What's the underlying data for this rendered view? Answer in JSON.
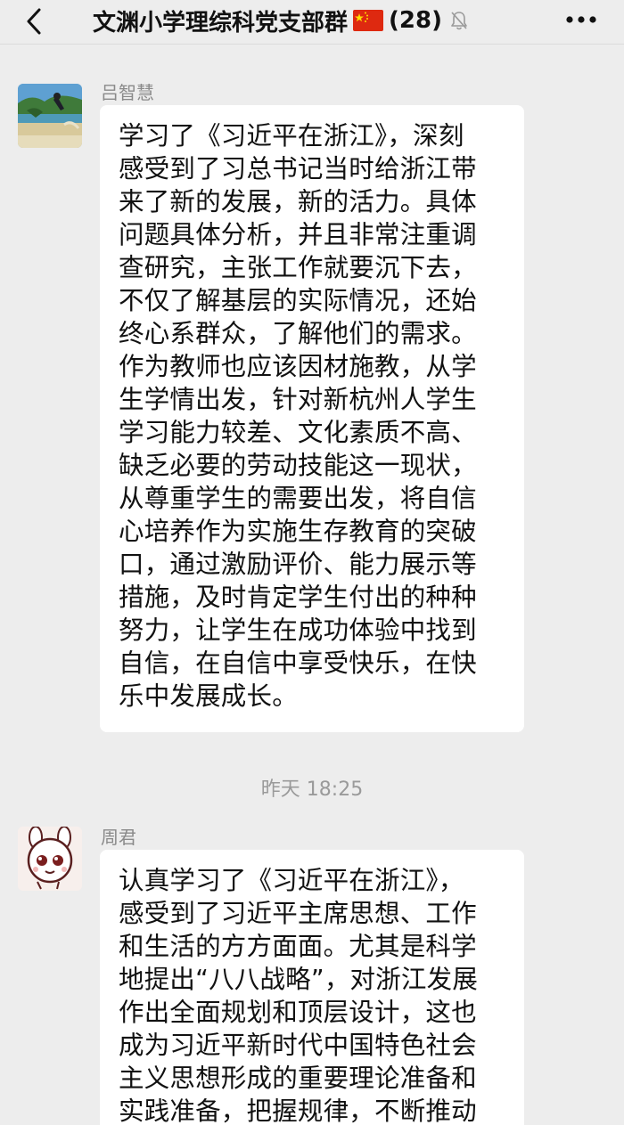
{
  "navbar": {
    "title": "文渊小学理综科党支部群",
    "member_count": "(28)",
    "back_icon": "chevron-left-icon",
    "flag_icon": "china-flag-icon",
    "mute_icon": "bell-muted-icon",
    "more_icon": "more-dots-icon"
  },
  "messages": [
    {
      "sender": "吕智慧",
      "avatar": "beach-photo-avatar",
      "lines": [
        "学习了《习近平在浙江》，深刻",
        "感受到了习总书记当时给浙江带",
        "来了新的发展，新的活力。具体",
        "问题具体分析，并且非常注重调",
        "查研究，主张工作就要沉下去，",
        "不仅了解基层的实际情况，还始",
        "终心系群众，了解他们的需求。",
        "作为教师也应该因材施教，从学",
        "生学情出发，针对新杭州人学生",
        "学习能力较差、文化素质不高、",
        "缺乏必要的劳动技能这一现状，",
        "从尊重学生的需要出发，将自信",
        "心培养作为实施生存教育的突破",
        "口，通过激励评价、能力展示等",
        "措施，及时肯定学生付出的种种",
        "努力，让学生在成功体验中找到",
        "自信，在自信中享受快乐，在快",
        "乐中发展成长。"
      ]
    },
    {
      "sender": "周君",
      "avatar": "cartoon-rabbit-avatar",
      "lines": [
        "认真学习了《习近平在浙江》，",
        "感受到了习近平主席思想、工作",
        "和生活的方方面面。尤其是科学",
        "地提出“八八战略”，对浙江发展",
        "作出全面规划和顶层设计，这也",
        "成为习近平新时代中国特色社会",
        "主义思想形成的重要理论准备和",
        "实践准备，把握规律，不断推动"
      ]
    }
  ],
  "timestamp": "昨天 18:25"
}
